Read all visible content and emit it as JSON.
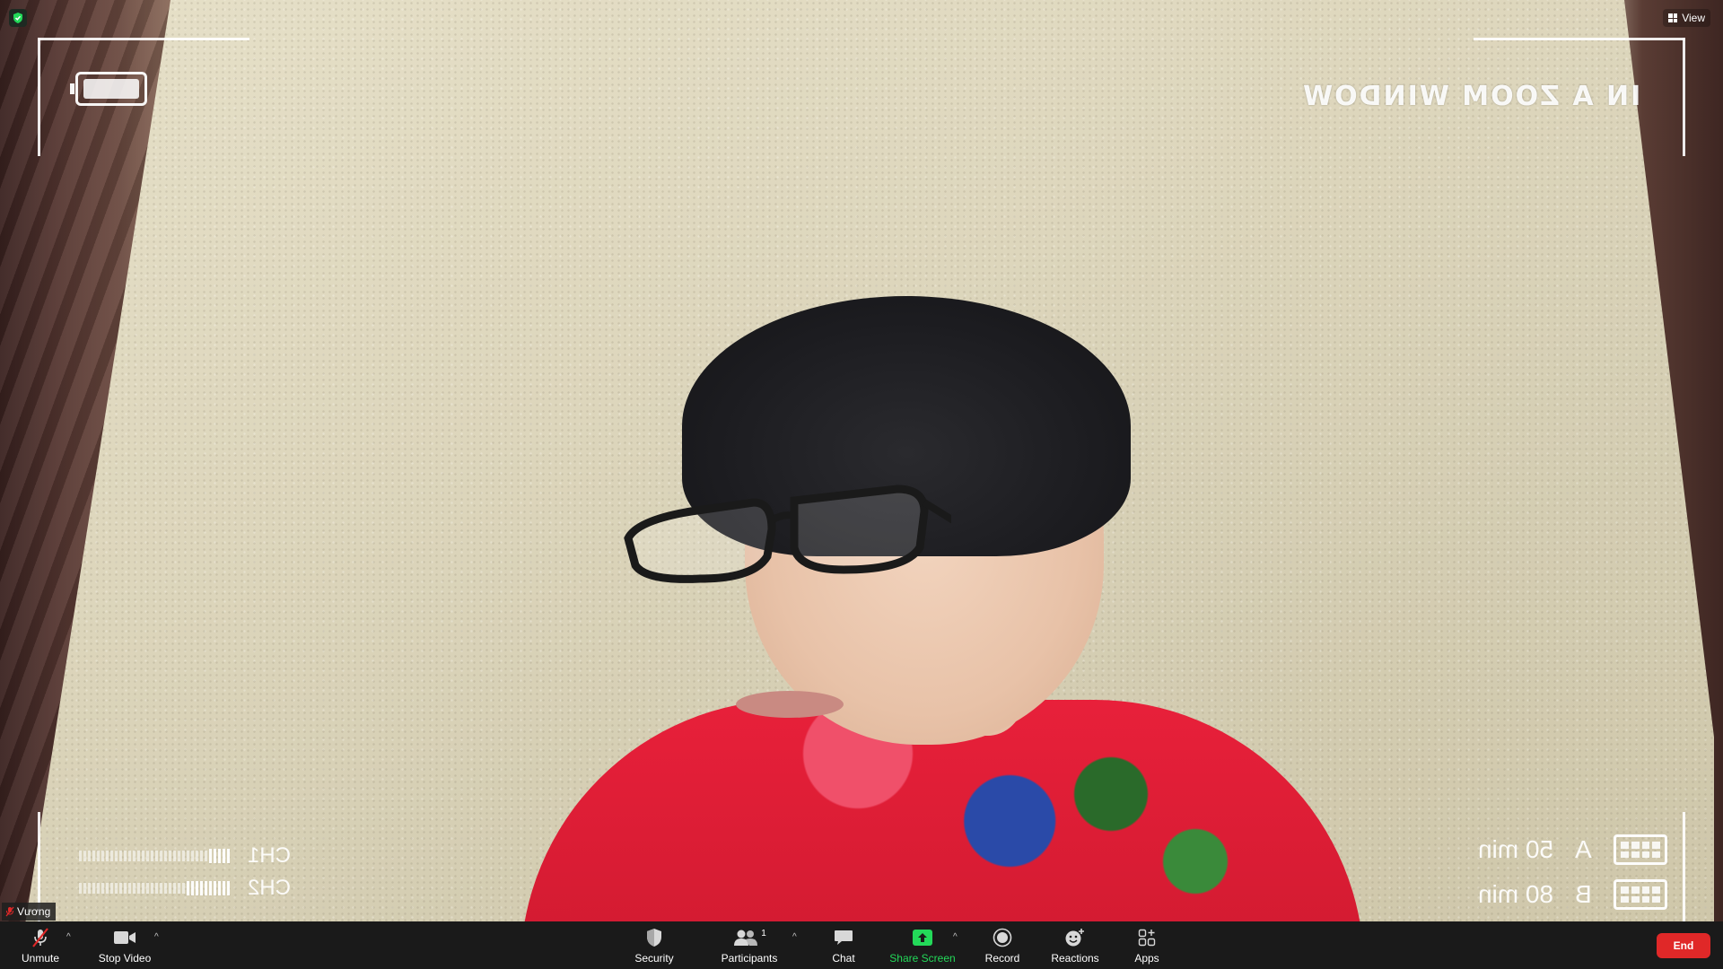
{
  "overlay": {
    "title": "IN A ZOOM WINDOW",
    "channels": [
      {
        "label": "CH1"
      },
      {
        "label": "CH2"
      }
    ],
    "media": [
      {
        "letter": "A",
        "time": "50 min"
      },
      {
        "letter": "B",
        "time": "80 min"
      }
    ]
  },
  "view_button": {
    "label": "View",
    "icon": "grid-icon"
  },
  "security_badge": {
    "icon": "shield-check-icon",
    "color": "#23d959"
  },
  "participant": {
    "name": "Vương",
    "mic_icon": "mic-muted-icon"
  },
  "toolbar": {
    "unmute": {
      "label": "Unmute",
      "icon": "mic-muted-icon"
    },
    "stop_video": {
      "label": "Stop Video",
      "icon": "video-camera-icon"
    },
    "security": {
      "label": "Security",
      "icon": "shield-icon"
    },
    "participants": {
      "label": "Participants",
      "count": "1",
      "icon": "people-icon"
    },
    "chat": {
      "label": "Chat",
      "icon": "chat-bubble-icon"
    },
    "share_screen": {
      "label": "Share Screen",
      "icon": "share-screen-icon",
      "color": "#23d959"
    },
    "record": {
      "label": "Record",
      "icon": "record-icon"
    },
    "reactions": {
      "label": "Reactions",
      "icon": "smiley-plus-icon"
    },
    "apps": {
      "label": "Apps",
      "icon": "apps-icon"
    },
    "end": {
      "label": "End",
      "color": "#e02828"
    }
  },
  "colors": {
    "toolbar_bg": "#1a1a1a",
    "accent_green": "#23d959",
    "end_red": "#e02828"
  }
}
